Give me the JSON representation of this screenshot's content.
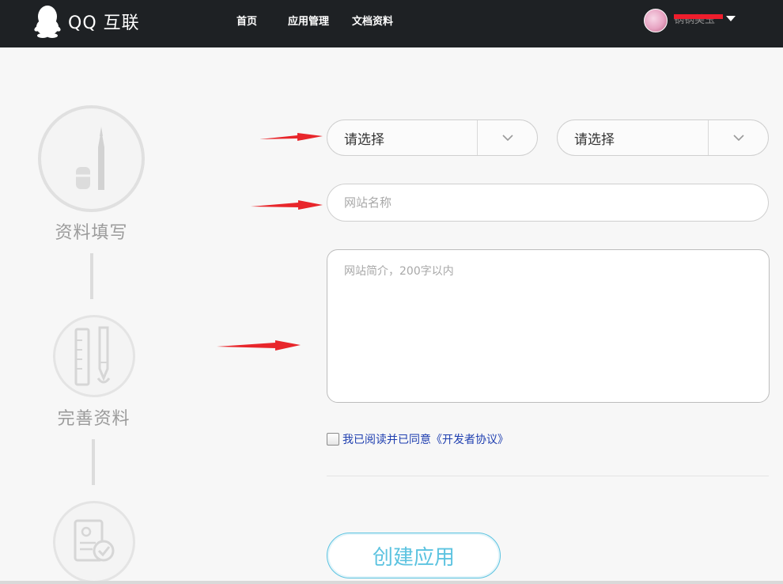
{
  "header": {
    "brand": "QQ 互联",
    "nav": [
      "首页",
      "应用管理",
      "文档资料"
    ],
    "username": "锅锅美玉"
  },
  "steps": [
    {
      "label": "资料填写"
    },
    {
      "label": "完善资料"
    },
    {
      "label": ""
    }
  ],
  "form": {
    "select1": "请选择",
    "select2": "请选择",
    "site_name_placeholder": "网站名称",
    "site_desc_placeholder": "网站简介，200字以内",
    "agree_text": "我已阅读并已同意《开发者协议》",
    "submit": "创建应用"
  },
  "colors": {
    "topbar": "#1e2124",
    "accent": "#5cc3e0",
    "link": "#1f3fb0",
    "annotation_arrow": "#e8262b"
  }
}
